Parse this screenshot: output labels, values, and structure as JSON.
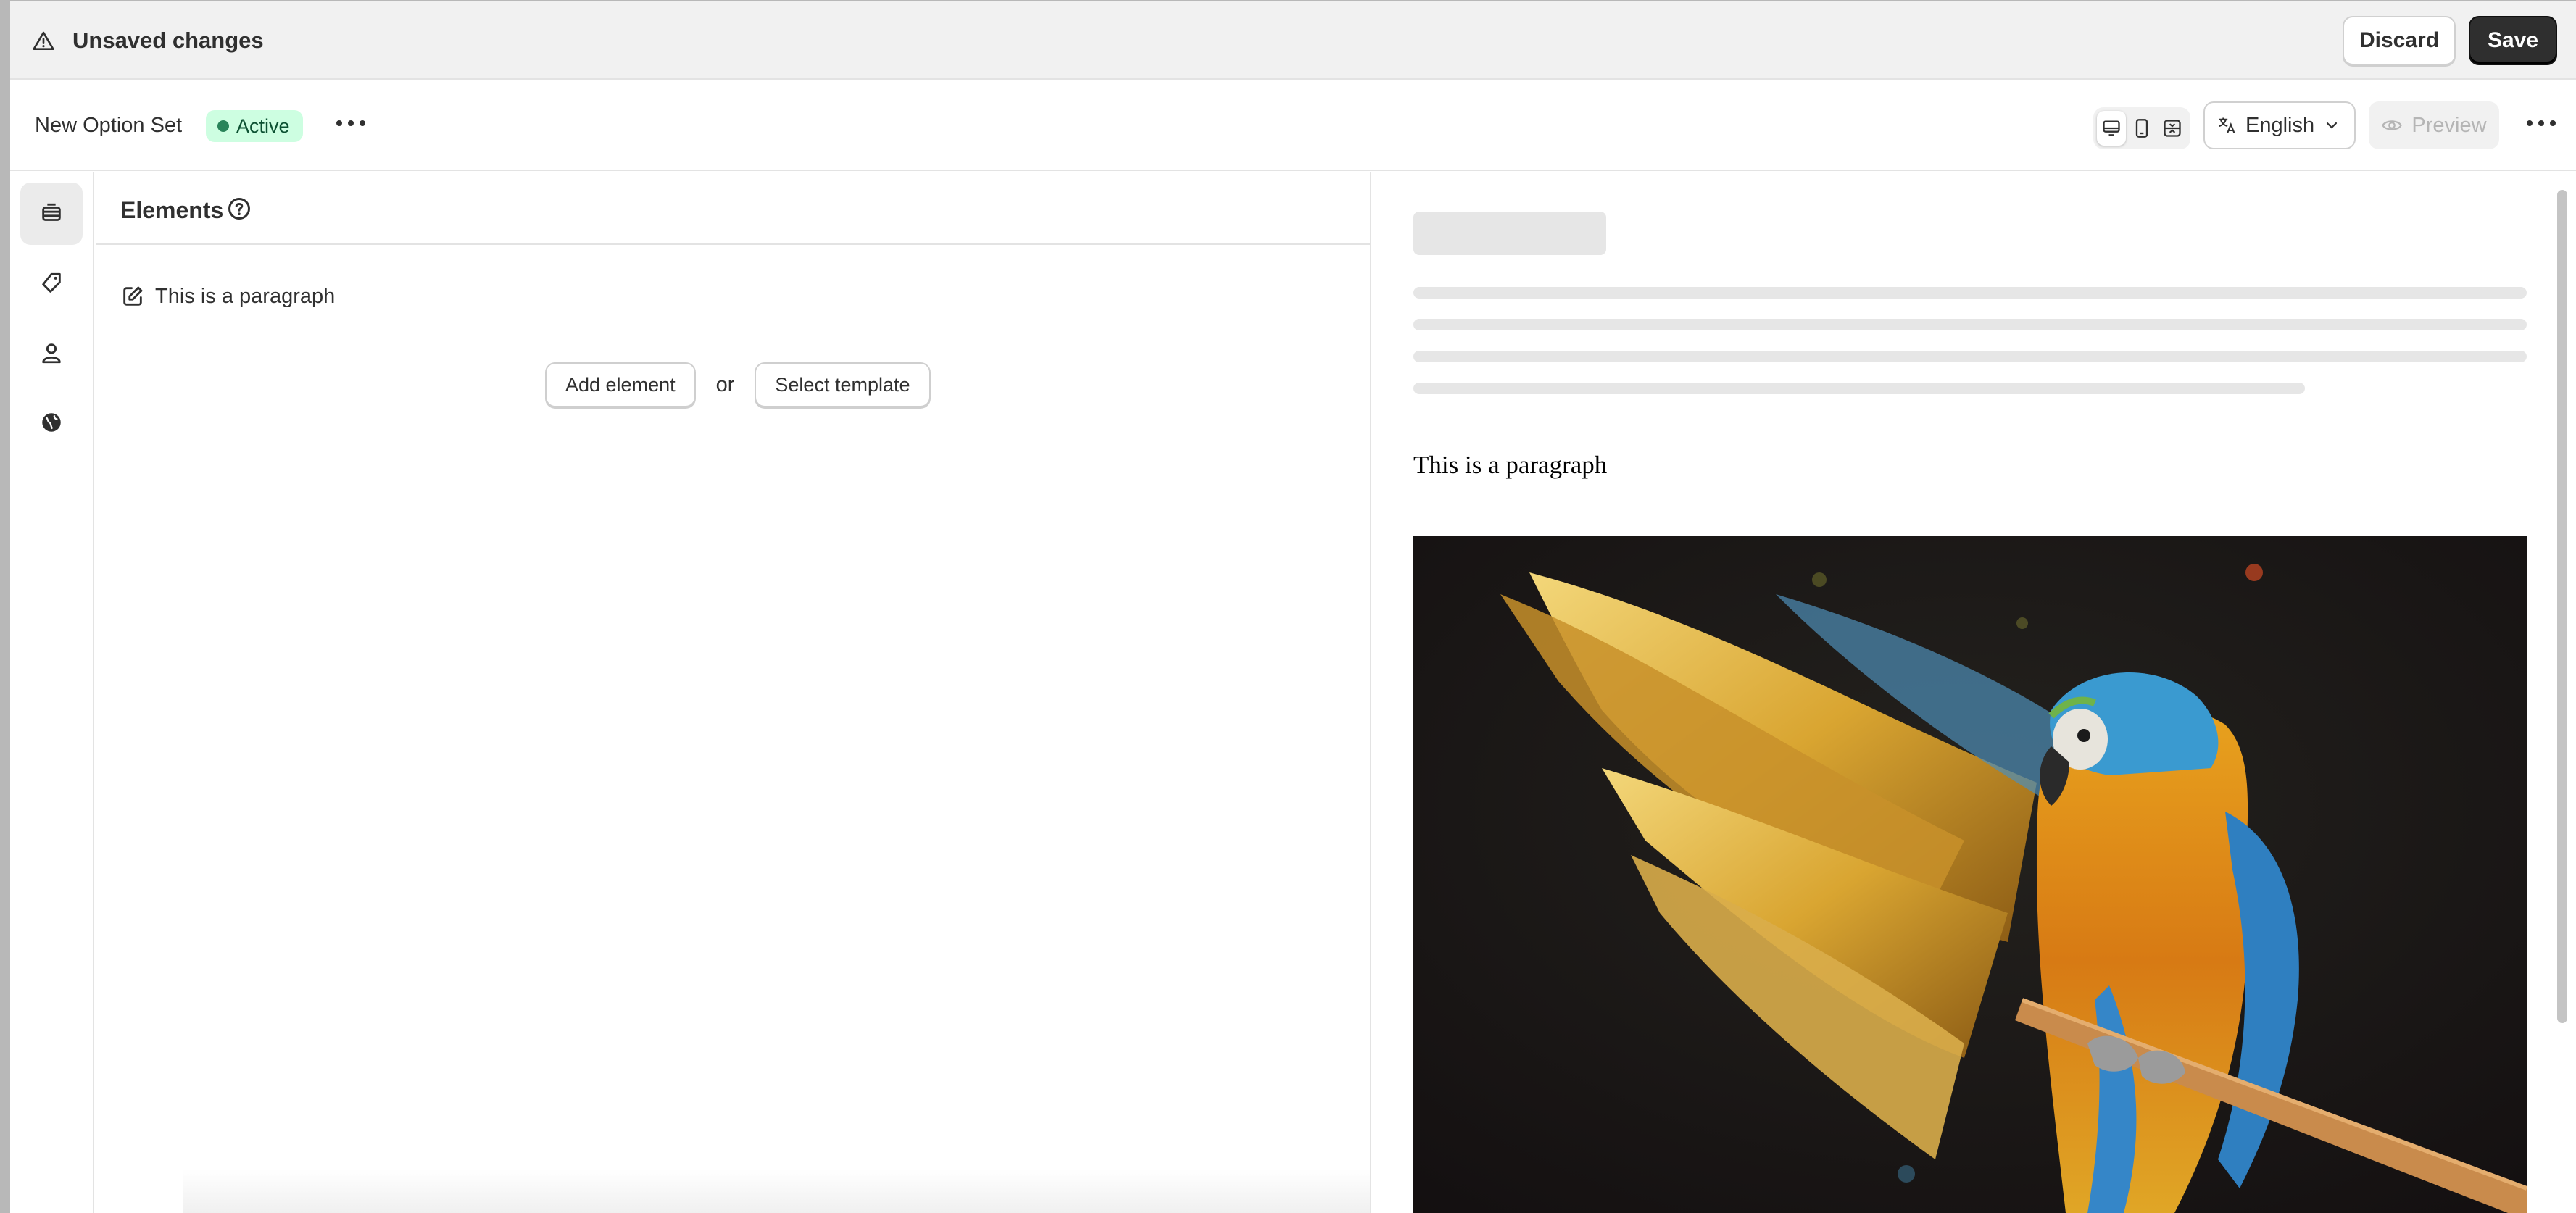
{
  "topbar": {
    "title": "Unsaved changes",
    "discard_label": "Discard",
    "save_label": "Save"
  },
  "header": {
    "set_name": "New Option Set",
    "status": "Active",
    "language": "English",
    "preview_label": "Preview"
  },
  "rail": {
    "items": [
      "elements-icon",
      "tag-icon",
      "person-icon",
      "globe-icon"
    ]
  },
  "panel": {
    "title": "Elements",
    "element_label": "This is a paragraph",
    "add_element_label": "Add element",
    "or_text": "or",
    "select_template_label": "Select template"
  },
  "preview": {
    "paragraph": "This is a paragraph"
  },
  "colors": {
    "badge_bg": "#cdfee1",
    "badge_dot": "#29845a",
    "save_bg": "#2f2f2f",
    "topbar_bg": "#f1f1f1"
  }
}
